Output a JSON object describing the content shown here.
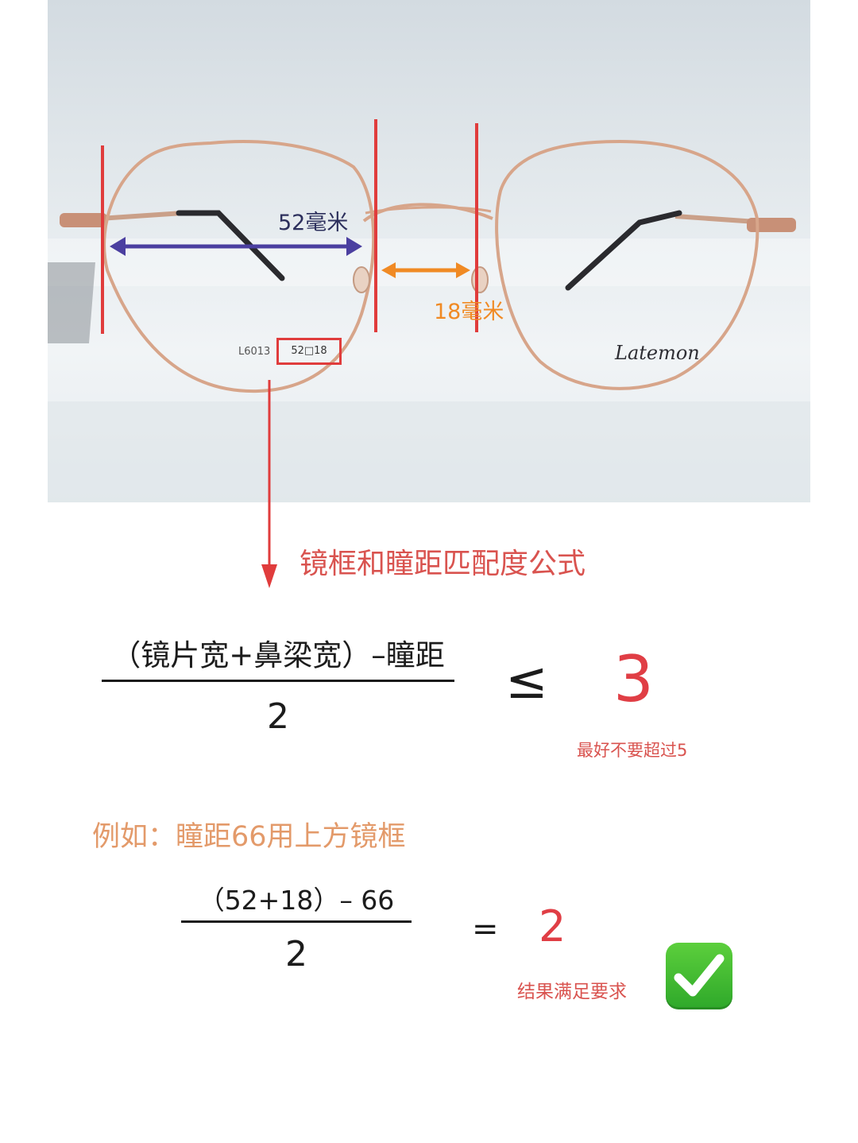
{
  "photo": {
    "lens_width_label": "52毫米",
    "bridge_width_label": "18毫米",
    "frame_model": "L6013",
    "size_marking": "52□18",
    "brand": "Latemon",
    "colors": {
      "marker_line": "#e03c3c",
      "lens_arrow": "#4b3fa0",
      "bridge_arrow": "#f08a24",
      "frame": "#d7a58a"
    }
  },
  "formula": {
    "heading": "镜框和瞳距匹配度公式",
    "numerator": "（镜片宽+鼻梁宽）–瞳距",
    "denominator": "2",
    "operator": "≤",
    "limit": "3",
    "note": "最好不要超过5"
  },
  "example": {
    "heading": "例如：瞳距66用上方镜框",
    "numerator": "（52+18）– 66",
    "denominator": "2",
    "operator": "=",
    "result": "2",
    "note": "结果满足要求",
    "icon": "check-mark-icon"
  }
}
